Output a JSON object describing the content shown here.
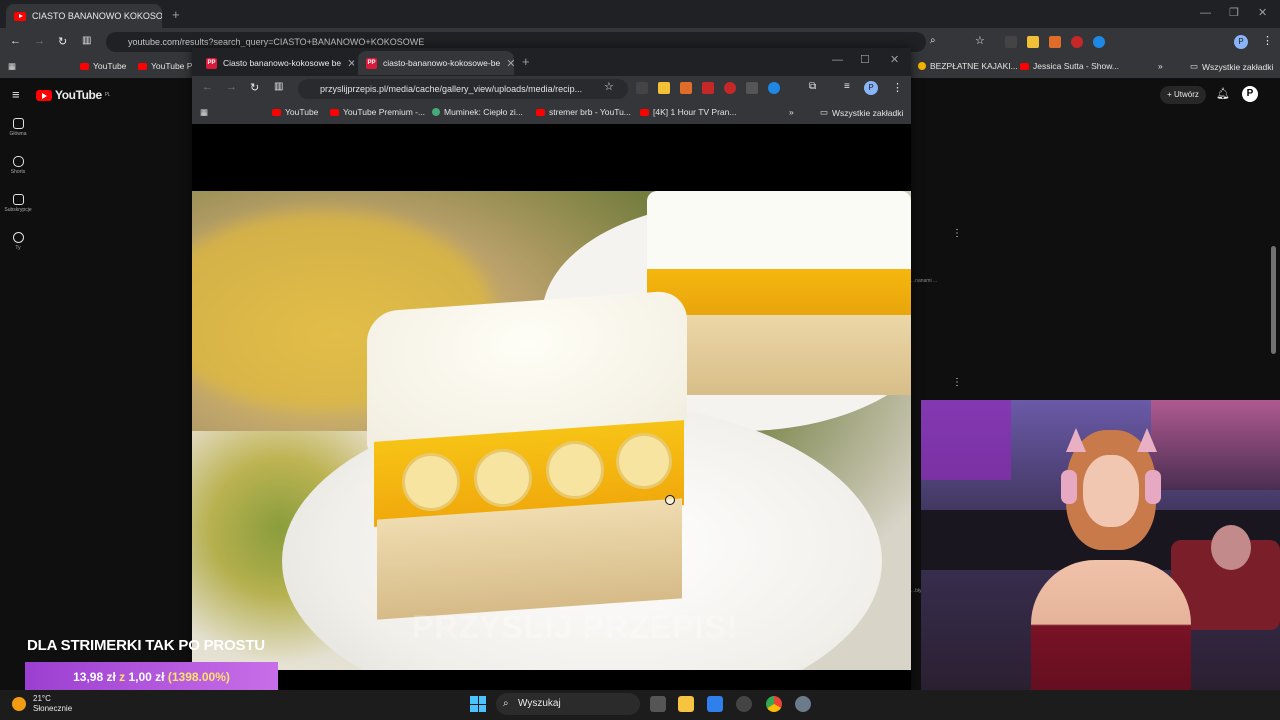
{
  "back_browser": {
    "tab_title": "CIASTO BANANOWO KOKOSO",
    "url": "youtube.com/results?search_query=CIASTO+BANANOWO+KOKOSOWE",
    "bookmarks": [
      "YouTube",
      "YouTube Pr",
      "BEZPŁATNE KAJAKI...",
      "Jessica Sutta - Show...",
      "Wszystkie zakładki"
    ]
  },
  "youtube": {
    "logo": "YouTube",
    "region": "PL",
    "create_label": "Utwórz",
    "sidebar": [
      {
        "label": "Główna",
        "icon": "home-icon"
      },
      {
        "label": "Shorts",
        "icon": "shorts-icon"
      },
      {
        "label": "Subskrypcje",
        "icon": "subscriptions-icon"
      },
      {
        "label": "Ty",
        "icon": "user-icon"
      }
    ],
    "snippet_1": "...nanami ...",
    "snippet_2": "...bły"
  },
  "front_browser": {
    "tabs": [
      {
        "title": "Ciasto bananowo-kokosowe be",
        "active": false
      },
      {
        "title": "ciasto-bananowo-kokosowe-be",
        "active": true
      }
    ],
    "url": "przyslijprzepis.pl/media/cache/gallery_view/uploads/media/recip...",
    "bookmarks": [
      "YouTube",
      "YouTube Premium -...",
      "Muminek: Ciepło zi...",
      "stremer brb - YouTu...",
      "[4K] 1 Hour TV Pran...",
      "Wszystkie zakładki"
    ],
    "watermark": "PRZYSLIJ PRZEPIS!"
  },
  "overlay": {
    "title": "DLA STRIMERKI TAK PO PROSTU",
    "price_from": "13,98 zł",
    "price_sep": "z",
    "price_to": "1,00 zł",
    "price_pct": "(1398.00%)"
  },
  "taskbar": {
    "temp": "21°C",
    "weather": "Słonecznie",
    "search_placeholder": "Wyszukaj"
  },
  "colors": {
    "youtube_red": "#ff0000",
    "promo_purple": "#9b3fd1",
    "promo_yellow": "#ffe36b"
  }
}
